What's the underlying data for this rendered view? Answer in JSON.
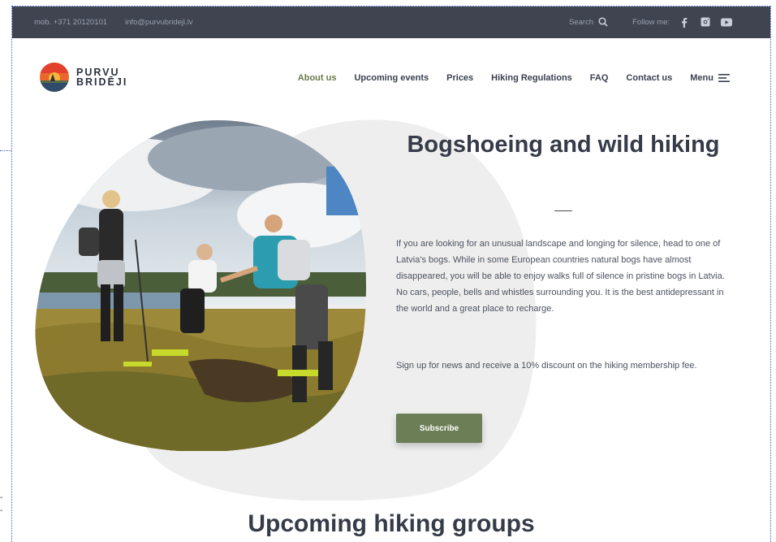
{
  "topbar": {
    "phone": "mob. +371 20120101",
    "email": "info@purvubrideji.lv",
    "search_label": "Search",
    "follow_label": "Follow me:",
    "social_icons": [
      "facebook-icon",
      "instagram-icon",
      "youtube-icon"
    ]
  },
  "logo": {
    "line1": "PURVU",
    "line2": "BRIDĒJI"
  },
  "nav": {
    "items": [
      "About us",
      "Upcoming events",
      "Prices",
      "Hiking Regulations",
      "FAQ",
      "Contact us"
    ],
    "menu_label": "Menu",
    "active": "About us"
  },
  "hero": {
    "title": "Bogshoeing and wild hiking",
    "paragraph1": "If you are looking for an unusual landscape and longing for silence, head to one of Latvia's bogs. While in some European countries natural bogs have almost disappeared, you will be able to enjoy walks full of silence in pristine bogs in Latvia. No cars, people, bells and whistles surrounding you. It is the best antidepressant in the world and a great place to recharge.",
    "paragraph2": "Sign up for news and receive a 10% discount on the hiking membership fee.",
    "subscribe_label": "Subscribe"
  },
  "section": {
    "title": "Upcoming hiking groups"
  },
  "colors": {
    "topbar_bg": "#3f4450",
    "accent": "#6b7e55",
    "blob": "#eeeeee"
  }
}
